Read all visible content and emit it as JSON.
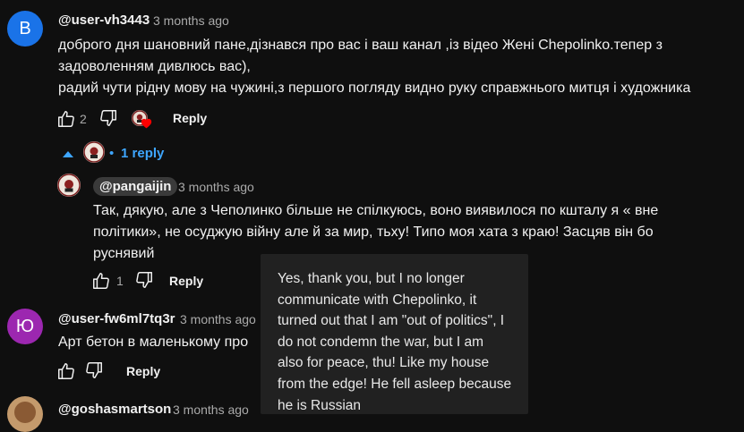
{
  "colors": {
    "background": "#0f0f0f",
    "link_blue": "#3ea6ff",
    "avatar_b": "#1a73e8",
    "avatar_yu": "#9c27b0",
    "tooltip_bg": "#212121",
    "heart": "#ff0000"
  },
  "comment1": {
    "avatar_letter": "B",
    "handle": "@user-vh3443",
    "time": "3 months ago",
    "lines": [
      "доброго дня шановний пане,дізнався про вас і ваш канал ,із відео Жені Chepolinko.тепер з",
      "задоволенням дивлюсь вас),",
      "радий чути рідну мову на чужині,з першого погляду видно руку справжнього митця і художника"
    ],
    "like_count": "2",
    "reply_label": "Reply",
    "icons": [
      "thumb-up-icon",
      "thumb-down-icon",
      "creator-heart-icon"
    ]
  },
  "replies_toggle": {
    "icon": "chevron-up-icon",
    "bullet": "•",
    "label": "1 reply"
  },
  "reply1": {
    "handle": "@pangaijin",
    "time": "3 months ago",
    "lines": [
      "Так, дякую, але з Чеполинко більше не спілкуюсь, воно виявилося по кшталу я « вне",
      "політики», не осуджую війну але й за мир, тьху! Типо моя хата з краю! Засцяв він бо",
      "руснявий"
    ],
    "like_count": "1",
    "reply_label": "Reply"
  },
  "comment2": {
    "avatar_letter": "Ю",
    "handle": "@user-fw6ml7tq3r",
    "time": "3 months ago",
    "text": "Арт бетон в маленькому про",
    "reply_label": "Reply"
  },
  "comment3": {
    "handle": "@goshasmartson",
    "time": "3 months ago"
  },
  "tooltip": {
    "lines": [
      "Yes, thank you, but I no longer",
      "communicate with Chepolinko, it",
      "turned out that I am \"out of politics\", I",
      "do not condemn the war, but I am",
      "also for peace, thu! Like my house",
      "from the edge! He fell asleep because",
      "he is Russian"
    ]
  }
}
